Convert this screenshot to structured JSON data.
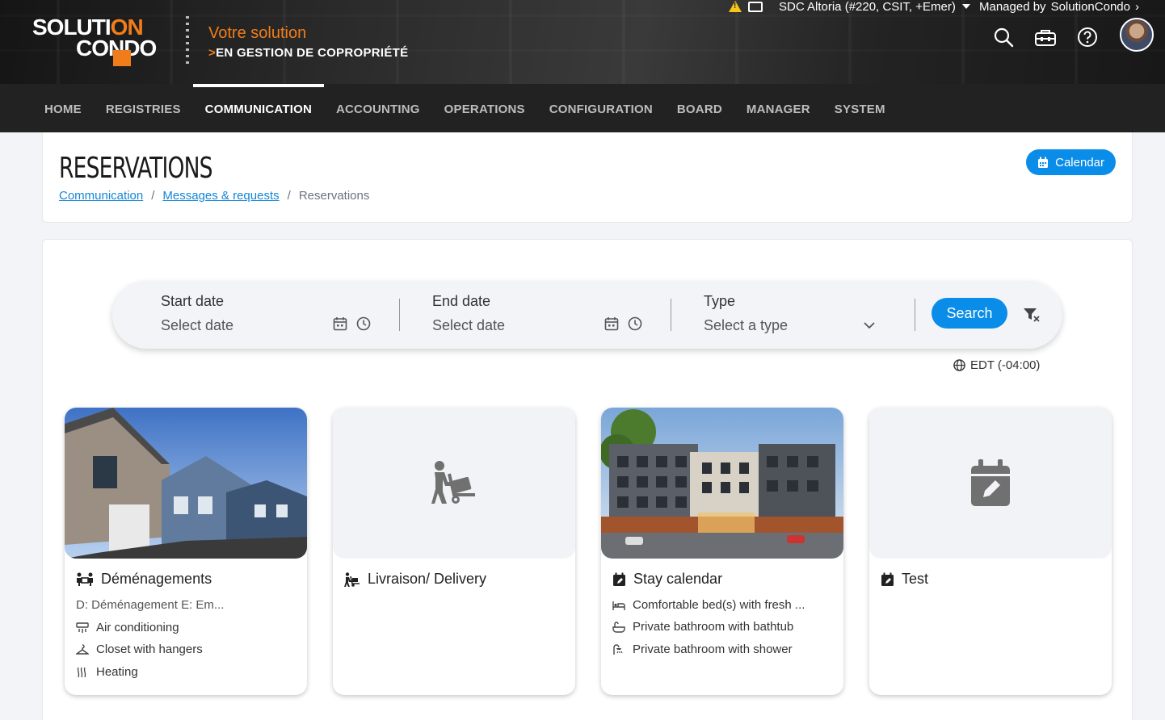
{
  "header": {
    "logo_line1": "SOLUTI",
    "logo_o1": "ON",
    "logo_line2": "CONDO",
    "tagline_1": "Votre solution",
    "tagline_2": "EN GESTION DE COPROPRIÉTÉ",
    "org_selector": "SDC Altoria (#220, CSIT, +Emer)",
    "managed_label": "Managed by",
    "managed_by": "SolutionCondo"
  },
  "nav": [
    {
      "label": "HOME",
      "active": false
    },
    {
      "label": "REGISTRIES",
      "active": false
    },
    {
      "label": "COMMUNICATION",
      "active": true
    },
    {
      "label": "ACCOUNTING",
      "active": false
    },
    {
      "label": "OPERATIONS",
      "active": false
    },
    {
      "label": "CONFIGURATION",
      "active": false
    },
    {
      "label": "BOARD",
      "active": false
    },
    {
      "label": "MANAGER",
      "active": false
    },
    {
      "label": "SYSTEM",
      "active": false
    }
  ],
  "page": {
    "title": "RESERVATIONS",
    "calendar_button": "Calendar",
    "breadcrumb": [
      "Communication",
      "Messages & requests",
      "Reservations"
    ]
  },
  "search": {
    "start_label": "Start date",
    "start_placeholder": "Select date",
    "end_label": "End date",
    "end_placeholder": "Select date",
    "type_label": "Type",
    "type_placeholder": "Select a type",
    "search_button": "Search",
    "timezone": "EDT (-04:00)"
  },
  "cards": [
    {
      "title": "Déménagements",
      "subtitle": "D: Déménagement E: Em...",
      "features": [
        "Air conditioning",
        "Closet with hangers",
        "Heating"
      ]
    },
    {
      "title": "Livraison/ Delivery",
      "subtitle": "",
      "features": []
    },
    {
      "title": "Stay calendar",
      "subtitle": "",
      "features": [
        "Comfortable bed(s) with fresh ...",
        "Private bathroom with bathtub",
        "Private bathroom with shower"
      ]
    },
    {
      "title": "Test",
      "subtitle": "",
      "features": []
    }
  ],
  "colors": {
    "accent": "#0a8de8",
    "brand_orange": "#f07d1a",
    "nav_bg": "#222222"
  }
}
